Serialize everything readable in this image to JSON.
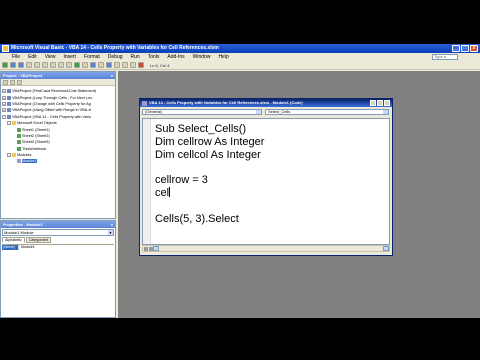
{
  "window": {
    "title": "Microsoft Visual Basic - VBA 14 - Cells Property with Variables for Cell References.xlsm"
  },
  "menu": [
    "File",
    "Edit",
    "View",
    "Insert",
    "Format",
    "Debug",
    "Run",
    "Tools",
    "Add-Ins",
    "Window",
    "Help"
  ],
  "help_placeholder": "Type a question for help",
  "toolbar": {
    "position": "Ln 6, Col 4"
  },
  "project": {
    "title": "Project - VBAProject",
    "tree": [
      {
        "label": "VBAProject (FirstCasd Revenue&Cost Statement)",
        "level": 0,
        "exp": "+",
        "icon": "proj"
      },
      {
        "label": "VBAProject (Loop Through Cells - For Next Loo",
        "level": 0,
        "exp": "+",
        "icon": "proj"
      },
      {
        "label": "VBAProject (Change with Cells Property for Ag",
        "level": 0,
        "exp": "+",
        "icon": "proj"
      },
      {
        "label": "VBAProject (Using Offset with Range in VBA.xl",
        "level": 0,
        "exp": "+",
        "icon": "proj"
      },
      {
        "label": "VBAProject (VBA 14 - Cells Property with Vario",
        "level": 0,
        "exp": "-",
        "icon": "proj"
      },
      {
        "label": "Microsoft Excel Objects",
        "level": 1,
        "exp": "-",
        "icon": "folder"
      },
      {
        "label": "Sheet1 (Sheet1)",
        "level": 2,
        "exp": "",
        "icon": "sheet"
      },
      {
        "label": "Sheet2 (Sheet2)",
        "level": 2,
        "exp": "",
        "icon": "sheet"
      },
      {
        "label": "Sheet3 (Sheet3)",
        "level": 2,
        "exp": "",
        "icon": "sheet"
      },
      {
        "label": "ThisWorkbook",
        "level": 2,
        "exp": "",
        "icon": "sheet"
      },
      {
        "label": "Modules",
        "level": 1,
        "exp": "-",
        "icon": "folder"
      },
      {
        "label": "Module1",
        "level": 2,
        "exp": "",
        "icon": "module",
        "selected": true
      }
    ]
  },
  "properties": {
    "title": "Properties - Module1",
    "combo": "Module1 Module",
    "tabs": [
      "Alphabetic",
      "Categorized"
    ],
    "rows": [
      {
        "key": "(Name)",
        "value": "Module1"
      }
    ]
  },
  "code_window": {
    "title": "VBA 14 - Cells Property with Variables for Cell References.xlsm - Module1 (Code)",
    "object_combo": "(General)",
    "proc_combo": "Select_Cells",
    "lines": [
      "Sub Select_Cells()",
      "Dim cellrow As Integer",
      "Dim cellcol As Integer",
      "",
      "cellrow = 3",
      "cel",
      "",
      "Cells(5, 3).Select"
    ]
  }
}
